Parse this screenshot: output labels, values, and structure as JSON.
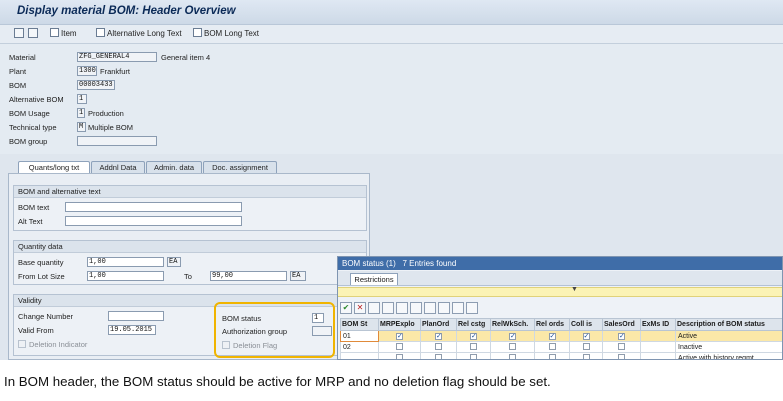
{
  "window": {
    "title": "Display material BOM: Header Overview"
  },
  "toolbar": {
    "item_label": "Item",
    "alt_long_text_label": "Alternative Long Text",
    "bom_long_text_label": "BOM Long Text"
  },
  "header": {
    "material_label": "Material",
    "material_value": "ZFG_GENERAL4",
    "material_desc": "General item 4",
    "plant_label": "Plant",
    "plant_value": "1300",
    "plant_desc": "Frankfurt",
    "bom_label": "BOM",
    "bom_value": "00003433",
    "alt_bom_label": "Alternative BOM",
    "alt_bom_value": "1",
    "bom_usage_label": "BOM Usage",
    "bom_usage_value": "1",
    "bom_usage_desc": "Production",
    "tech_type_label": "Technical type",
    "tech_type_value": "M",
    "tech_type_desc": "Multiple BOM",
    "bom_group_label": "BOM group",
    "bom_group_value": ""
  },
  "tabs": [
    "Quants/long txt",
    "Addnl Data",
    "Admin. data",
    "Doc. assignment"
  ],
  "bom_text_group": {
    "title": "BOM and alternative text",
    "bom_text_label": "BOM text",
    "bom_text_value": "",
    "alt_text_label": "Alt Text",
    "alt_text_value": ""
  },
  "quantity_group": {
    "title": "Quantity data",
    "base_qty_label": "Base quantity",
    "base_qty_value": "1,00",
    "base_qty_unit": "EA",
    "from_lot_label": "From Lot Size",
    "from_lot_value": "1,00",
    "to_label": "To",
    "to_value": "99,00",
    "lot_unit": "EA"
  },
  "validity_group": {
    "title": "Validity",
    "change_number_label": "Change Number",
    "change_number_value": "",
    "valid_from_label": "Valid From",
    "valid_from_value": "19.05.2015",
    "deletion_indicator_label": "Deletion Indicator",
    "bom_status_label": "BOM status",
    "bom_status_value": "1",
    "auth_group_label": "Authorization group",
    "auth_group_value": "",
    "deletion_flag_label": "Deletion Flag"
  },
  "popup": {
    "title": "BOM status (1)",
    "entries": "7 Entries found",
    "restrictions_tab": "Restrictions",
    "columns": [
      "BOM St",
      "MRPExplo",
      "PlanOrd",
      "Rel cstg",
      "RelWkSch.",
      "Rel ords",
      "Coll is",
      "SalesOrd",
      "ExMs ID",
      "Description of BOM status"
    ],
    "rows": [
      {
        "status": "01",
        "mrp": true,
        "plan": true,
        "cstg": true,
        "wks": true,
        "ords": true,
        "coll": true,
        "sales": true,
        "exms": "",
        "desc": "Active"
      },
      {
        "status": "02",
        "mrp": false,
        "plan": false,
        "cstg": false,
        "wks": false,
        "ords": false,
        "coll": false,
        "sales": false,
        "exms": "",
        "desc": "Inactive"
      },
      {
        "status": "",
        "mrp": false,
        "plan": false,
        "cstg": false,
        "wks": false,
        "ords": false,
        "coll": false,
        "sales": false,
        "exms": "",
        "desc": "Active with history reqmt"
      }
    ]
  },
  "caption": "In BOM header, the BOM status should be active for MRP and no deletion flag should be set.",
  "colors": {
    "highlight": "#f0b400",
    "popup_title": "#3f6da8",
    "selected_row": "#fbe8a8"
  }
}
